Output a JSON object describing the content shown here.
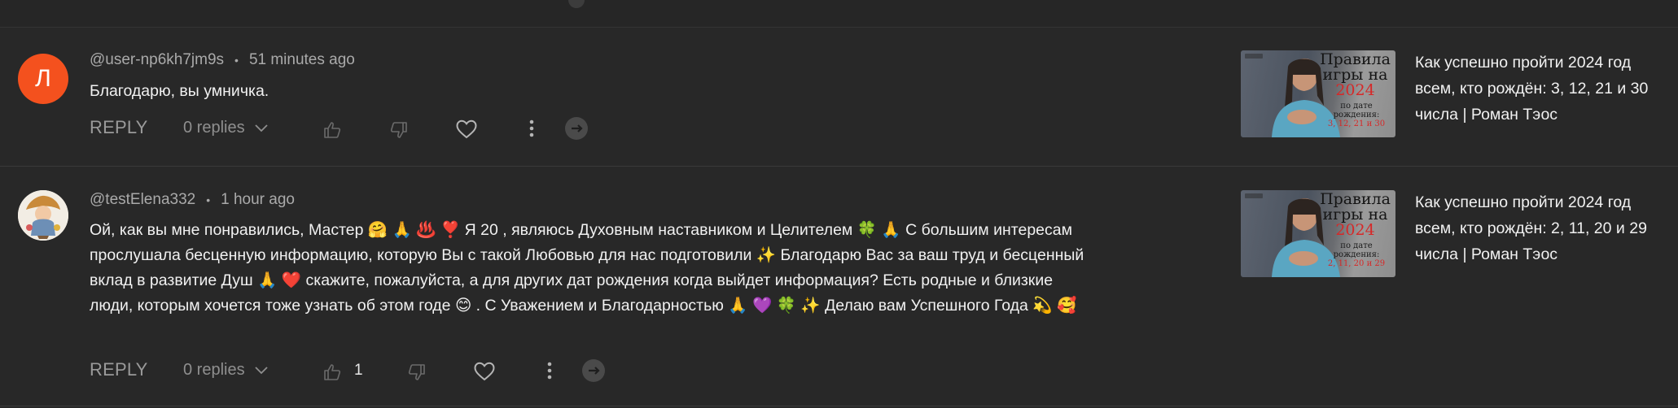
{
  "comments": [
    {
      "avatar_letter": "Л",
      "avatar_color": "#f4511e",
      "username": "@user-np6kh7jm9s",
      "separator": "•",
      "time": "51 minutes ago",
      "text": "Благодарю, вы умничка.",
      "reply_label": "REPLY",
      "replies_label": "0 replies",
      "like_count": "",
      "video": {
        "thumb_title": "Правила игры на",
        "thumb_year": "2024",
        "thumb_sub": "по дате рождения:",
        "thumb_dates": "3, 12, 21 и 30",
        "title": "Как успешно пройти 2024 год всем, кто рождён: 3, 12, 21 и 30 числа | Роман Тэос"
      }
    },
    {
      "avatar_letter": "",
      "avatar_color": "#f2ede4",
      "username": "@testElena332",
      "separator": "•",
      "time": "1 hour ago",
      "text": "Ой, как вы мне понравились,    Мастер 🤗 🙏 ♨️ ❣️ Я 20 , являюсь Духовным наставником и Целителем  🍀 🙏  С большим интересам прослушала бесценную информацию, которую Вы с такой Любовью для нас подготовили ✨  Благодарю Вас за ваш труд и бесценный вклад в развитие Душ 🙏 ❤️  скажите, пожалуйста, а для других дат рождения когда выйдет информация? Есть родные и близкие люди, которым хочется тоже узнать об этом годе 😊 . С Уважением и Благодарностью 🙏 💜 🍀 ✨ Делаю вам Успешного Года 💫 🥰",
      "reply_label": "REPLY",
      "replies_label": "0 replies",
      "like_count": "1",
      "video": {
        "thumb_title": "Правила игры на",
        "thumb_year": "2024",
        "thumb_sub": "по дате рождения:",
        "thumb_dates": "2, 11, 20 и 29",
        "title": "Как успешно пройти 2024 год всем, кто рождён: 2, 11, 20 и 29 числа | Роман Тэос"
      }
    }
  ],
  "icons": {
    "replies_toggle": "chevron-down-icon",
    "like": "thumbs-up-icon",
    "dislike": "thumbs-down-icon",
    "heart": "heart-icon",
    "more": "more-vertical-icon",
    "extra": "circle-badge-icon"
  },
  "colors": {
    "background": "#282828",
    "text": "#f1f1f1",
    "muted": "#aaaaaa",
    "accent_red": "#d62828"
  }
}
